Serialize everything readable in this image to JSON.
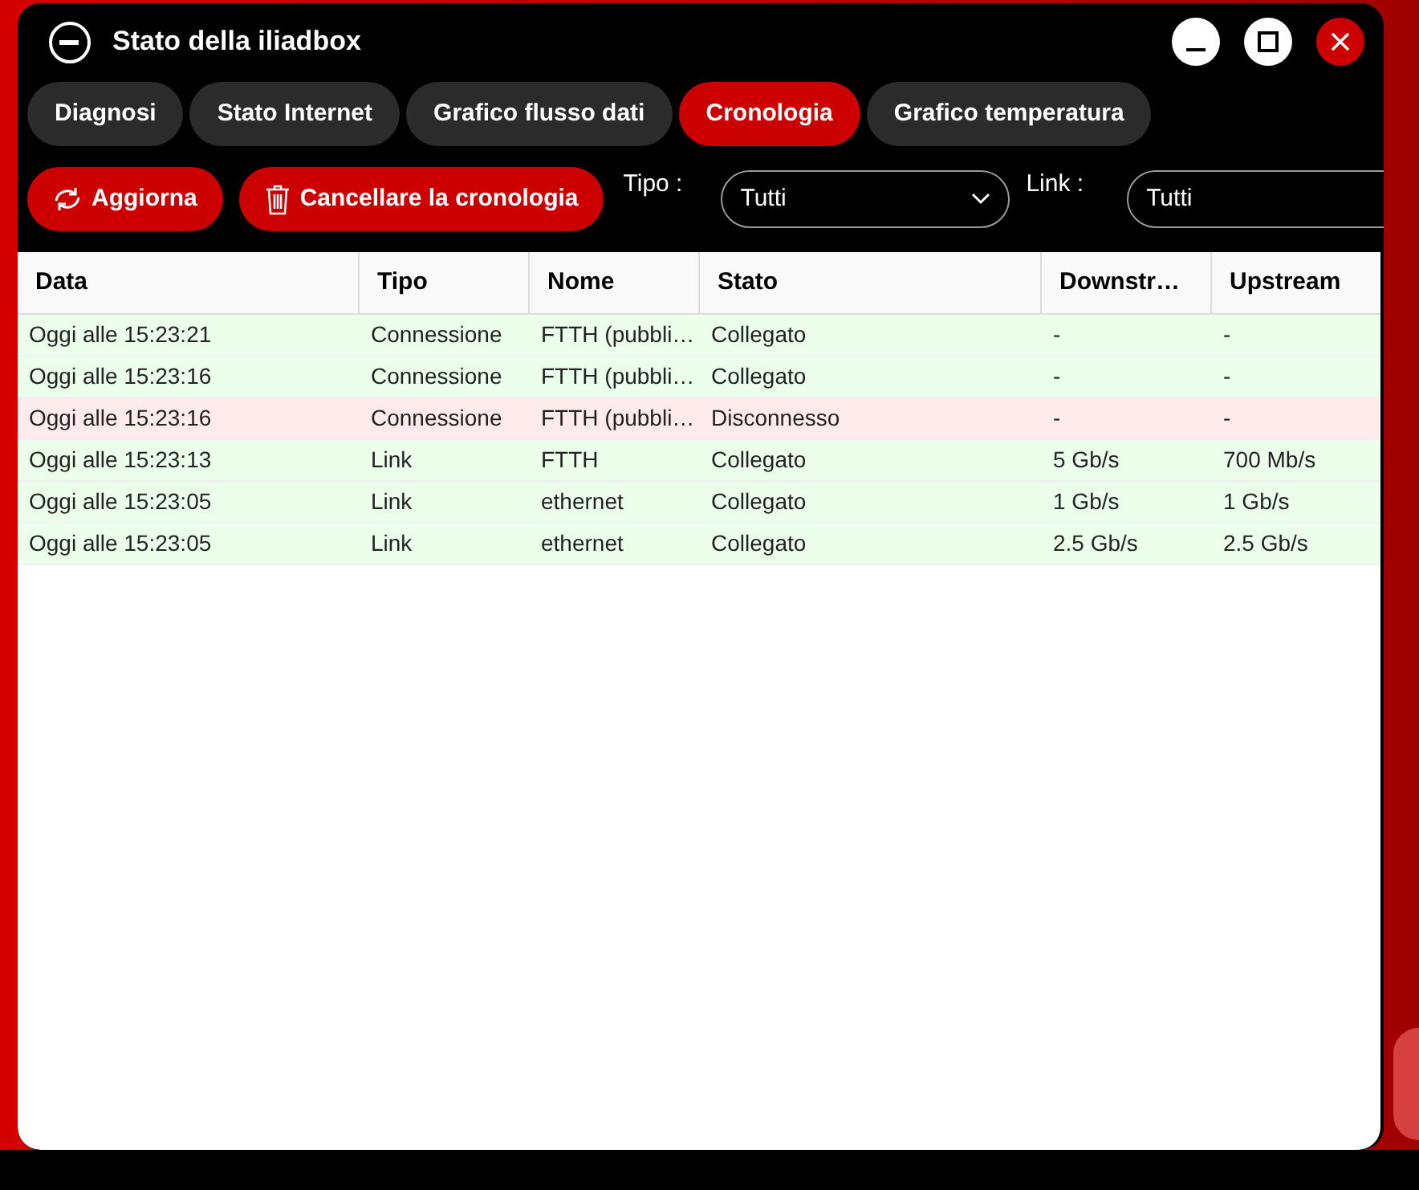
{
  "window": {
    "title": "Stato della iliadbox"
  },
  "tabs": [
    {
      "label": "Diagnosi",
      "selected": false
    },
    {
      "label": "Stato Internet",
      "selected": false
    },
    {
      "label": "Grafico flusso dati",
      "selected": false
    },
    {
      "label": "Cronologia",
      "selected": true
    },
    {
      "label": "Grafico temperatura",
      "selected": false
    }
  ],
  "toolbar": {
    "refresh": "Aggiorna",
    "clear": "Cancellare la cronologia",
    "type_label": "Tipo :",
    "type_value": "Tutti",
    "link_label": "Link :",
    "link_value": "Tutti"
  },
  "table": {
    "columns": [
      "Data",
      "Tipo",
      "Nome",
      "Stato",
      "Downstr…",
      "Upstream"
    ],
    "rows": [
      {
        "cells": [
          "Oggi alle 15:23:21",
          "Connessione",
          "FTTH (pubbli…",
          "Collegato",
          "-",
          "-"
        ],
        "color": "#ebffeb"
      },
      {
        "cells": [
          "Oggi alle 15:23:16",
          "Connessione",
          "FTTH (pubbli…",
          "Collegato",
          "-",
          "-"
        ],
        "color": "#ebffeb"
      },
      {
        "cells": [
          "Oggi alle 15:23:16",
          "Connessione",
          "FTTH (pubbli…",
          "Disconnesso",
          "-",
          "-"
        ],
        "color": "#ffebeb"
      },
      {
        "cells": [
          "Oggi alle 15:23:13",
          "Link",
          "FTTH",
          "Collegato",
          "5 Gb/s",
          "700 Mb/s"
        ],
        "color": "#ebffeb"
      },
      {
        "cells": [
          "Oggi alle 15:23:05",
          "Link",
          "ethernet",
          "Collegato",
          "1 Gb/s",
          "1 Gb/s"
        ],
        "color": "#ebffeb"
      },
      {
        "cells": [
          "Oggi alle 15:23:05",
          "Link",
          "ethernet",
          "Collegato",
          "2.5 Gb/s",
          "2.5 Gb/s"
        ],
        "color": "#ebffeb"
      }
    ]
  }
}
